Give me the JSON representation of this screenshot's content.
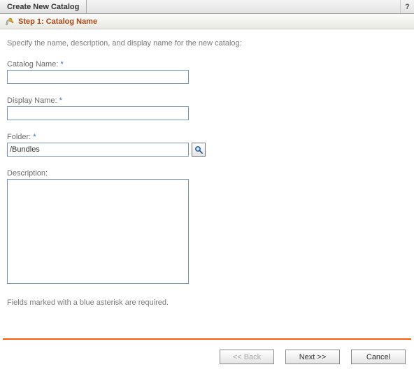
{
  "titleBar": {
    "title": "Create New Catalog",
    "help": "?"
  },
  "stepBar": {
    "title": "Step 1: Catalog Name"
  },
  "instruction": "Specify the name, description, and display name for the new catalog:",
  "fields": {
    "catalogName": {
      "label": "Catalog Name:",
      "value": "",
      "asterisk": "*"
    },
    "displayName": {
      "label": "Display Name:",
      "value": "",
      "asterisk": "*"
    },
    "folder": {
      "label": "Folder:",
      "value": "/Bundles",
      "asterisk": "*"
    },
    "description": {
      "label": "Description:",
      "value": ""
    }
  },
  "requiredNote": "Fields marked with a blue asterisk are required.",
  "buttons": {
    "back": "<< Back",
    "next": "Next >>",
    "cancel": "Cancel"
  }
}
